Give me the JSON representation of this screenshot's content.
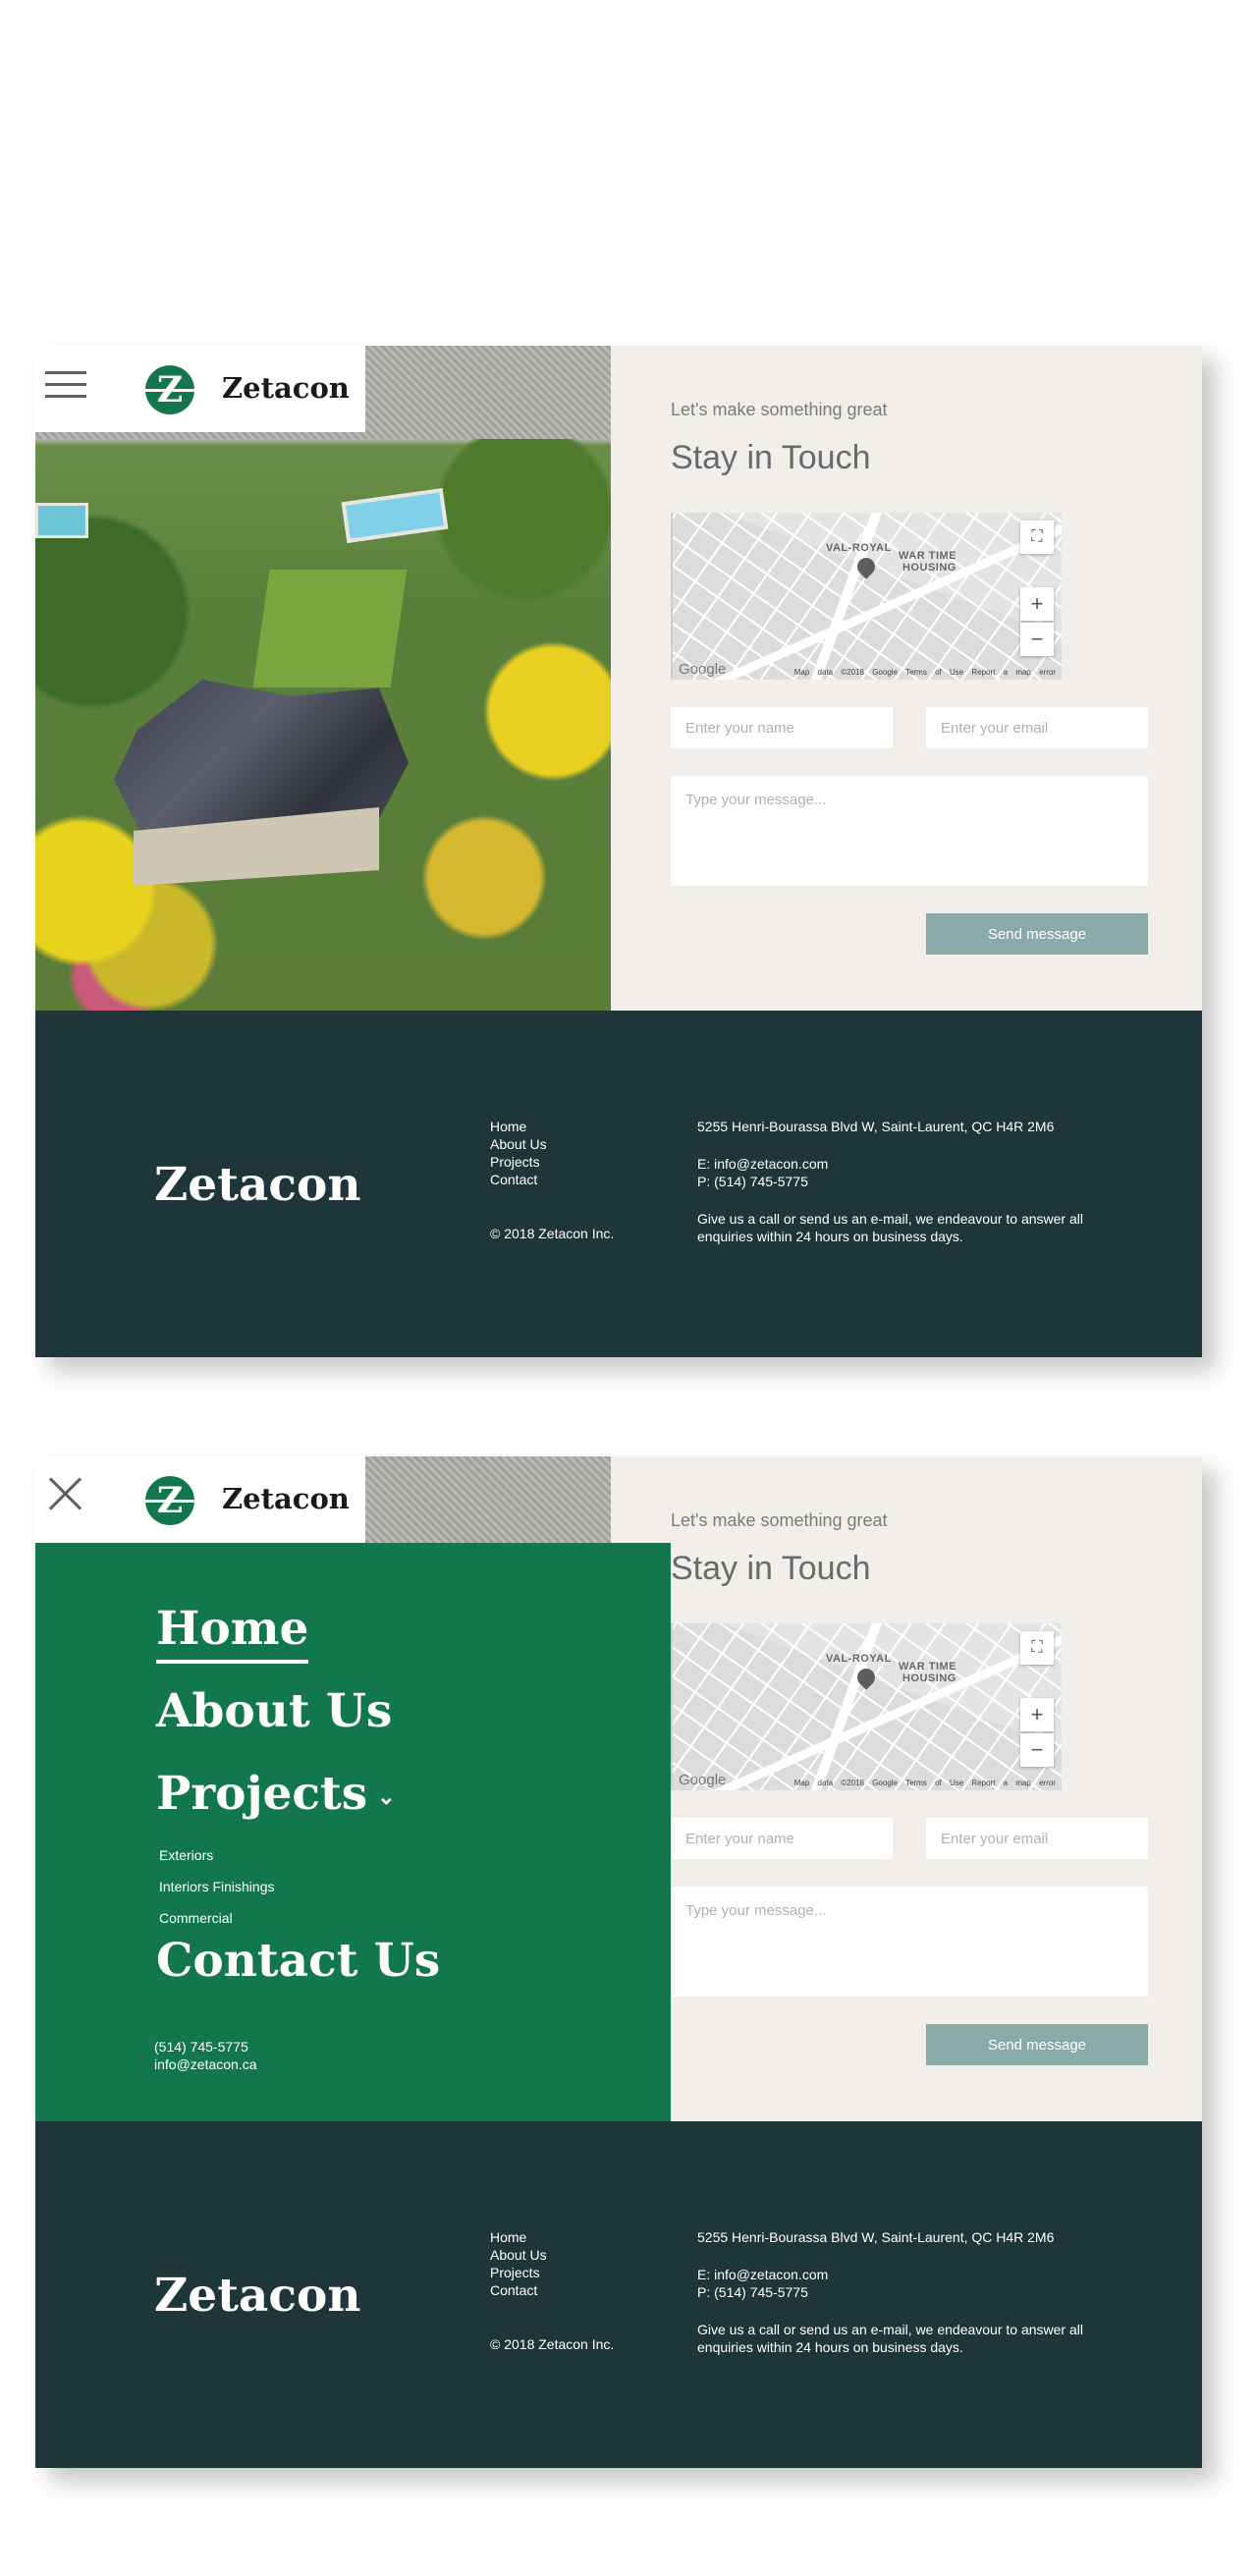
{
  "brand": {
    "name": "Zetacon",
    "mark": "Z"
  },
  "hero": {
    "alt": "Aerial view of a stone house surrounded by autumn trees"
  },
  "contact": {
    "eyebrow": "Let's make something great",
    "title": "Stay in Touch",
    "map": {
      "labels": [
        "VAL-ROYAL",
        "WAR TIME",
        "HOUSING"
      ],
      "zoom_in": "+",
      "zoom_out": "−",
      "fullscreen": "⛶",
      "google": "Google",
      "attribution": "Map data ©2018 Google  Terms of Use  Report a map error"
    },
    "name_placeholder": "Enter your name",
    "email_placeholder": "Enter your email",
    "message_placeholder": "Type your message...",
    "send_label": "Send message"
  },
  "menu": {
    "items": [
      "Home",
      "About Us",
      "Projects",
      "Contact Us"
    ],
    "projects_chevron": "⌄",
    "subitems": [
      "Exteriors",
      "Interiors Finishings",
      "Commercial"
    ],
    "phone": "(514) 745-5775",
    "email": "info@zetacon.ca"
  },
  "footer": {
    "brand": "Zetacon",
    "links": [
      "Home",
      "About Us",
      "Projects",
      "Contact"
    ],
    "copyright": "© 2018 Zetacon Inc.",
    "address": "5255 Henri-Bourassa Blvd W, Saint-Laurent, QC H4R 2M6",
    "email": "E: info@zetacon.com",
    "phone": "P: (514) 745-5775",
    "blurb": "Give us a call or send us an e-mail, we endeavour to answer all enquiries within 24 hours on business days."
  },
  "colors": {
    "brand_green": "#13774d",
    "footer_bg": "#1e3539",
    "panel_bg": "#f2efea",
    "button": "#8aa9a9"
  }
}
